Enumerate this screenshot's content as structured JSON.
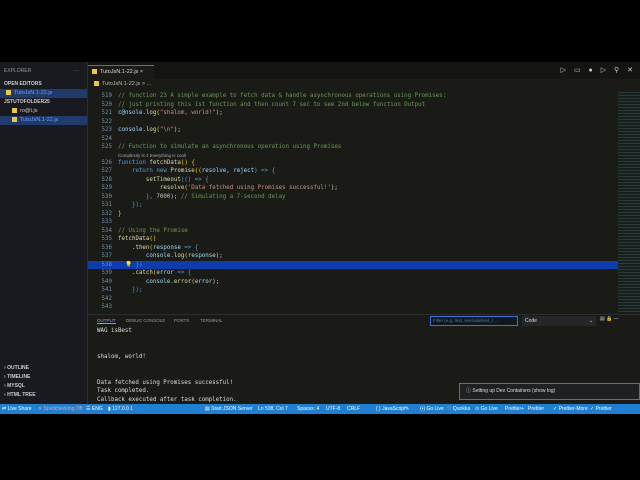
{
  "sidebar": {
    "title": "EXPLORER",
    "more": "···",
    "open_editors": "OPEN EDITORS",
    "open_file": "TutoJsN.1-22.js",
    "folder": "JSTUTOFOLDER25",
    "files": [
      "ro@t.js",
      "TutoJsN.1-22.js"
    ],
    "sections": [
      "OUTLINE",
      "TIMELINE",
      "MYSQL",
      "HTML TREE"
    ]
  },
  "tab": {
    "label": "TutoJsN.1-22.js",
    "close": "×"
  },
  "toolbar": {
    "icons": "▷ ▭ ● ▷ ⚲ ✕"
  },
  "breadcrumb": "TutoJsN.1-22.js > ...",
  "code": {
    "lens": "Complexity is 4 Everything is cool!",
    "lines": [
      {
        "n": "519",
        "t": [
          [
            "// function 23 A simple example to fetch data & handle asynchronous operations using Promises:",
            "c"
          ]
        ]
      },
      {
        "n": "520",
        "t": [
          [
            "// just printing this 1st function and then count 7 sec to see 2nd below function Output",
            "c"
          ]
        ]
      },
      {
        "n": "521",
        "t": [
          [
            "c@nsole",
            "v"
          ],
          [
            ".",
            "p"
          ],
          [
            "log",
            "f"
          ],
          [
            "(",
            "y"
          ],
          [
            "\"shalom, world!\"",
            "s"
          ],
          [
            ")",
            "y"
          ],
          [
            ";",
            "p"
          ]
        ]
      },
      {
        "n": "522",
        "t": []
      },
      {
        "n": "523",
        "t": [
          [
            "console",
            "v"
          ],
          [
            ".",
            "p"
          ],
          [
            "log",
            "f"
          ],
          [
            "(",
            "y"
          ],
          [
            "\"\\n\"",
            "s"
          ],
          [
            ")",
            "y"
          ],
          [
            ";",
            "p"
          ]
        ]
      },
      {
        "n": "524",
        "t": []
      },
      {
        "n": "525",
        "t": [
          [
            "// Function to simulate an asynchronous operation using Promises",
            "c"
          ]
        ]
      },
      {
        "n": "526",
        "t": [
          [
            "function ",
            "k"
          ],
          [
            "fetchData",
            "f"
          ],
          [
            "() {",
            "y"
          ]
        ],
        "lens": true
      },
      {
        "n": "527",
        "t": [
          [
            "    return new ",
            "k"
          ],
          [
            "Promise",
            "f"
          ],
          [
            "((",
            "y"
          ],
          [
            "resolve",
            "v"
          ],
          [
            ", ",
            "p"
          ],
          [
            "reject",
            "v"
          ],
          [
            ") => {",
            "k"
          ]
        ]
      },
      {
        "n": "528",
        "t": [
          [
            "        setTimeout",
            "f"
          ],
          [
            "(() => {",
            "k"
          ]
        ]
      },
      {
        "n": "529",
        "t": [
          [
            "            resolve",
            "f"
          ],
          [
            "(",
            "y"
          ],
          [
            "'Data fetched using Promises successful!'",
            "s"
          ],
          [
            ");",
            "p"
          ]
        ]
      },
      {
        "n": "530",
        "t": [
          [
            "        }, ",
            "k"
          ],
          [
            "7000",
            "n"
          ],
          [
            "); ",
            "p"
          ],
          [
            "// Simulating a 7-second delay",
            "c"
          ]
        ]
      },
      {
        "n": "531",
        "t": [
          [
            "    });",
            "k"
          ]
        ]
      },
      {
        "n": "532",
        "t": [
          [
            "}",
            "y"
          ]
        ]
      },
      {
        "n": "533",
        "t": []
      },
      {
        "n": "534",
        "t": [
          [
            "// Using the Promise",
            "c"
          ]
        ]
      },
      {
        "n": "535",
        "t": [
          [
            "fetchData",
            "f"
          ],
          [
            "()",
            "y"
          ]
        ]
      },
      {
        "n": "536",
        "t": [
          [
            "    .",
            "p"
          ],
          [
            "then",
            "f"
          ],
          [
            "(",
            "y"
          ],
          [
            "response",
            "v"
          ],
          [
            " => {",
            "k"
          ]
        ]
      },
      {
        "n": "537",
        "t": [
          [
            "        console",
            "v"
          ],
          [
            ".",
            "p"
          ],
          [
            "log",
            "f"
          ],
          [
            "(",
            "y"
          ],
          [
            "response",
            "v"
          ],
          [
            ");",
            "p"
          ]
        ]
      },
      {
        "n": "538",
        "t": [
          [
            "  💡 })",
            "k"
          ]
        ],
        "cur": true
      },
      {
        "n": "539",
        "t": [
          [
            "    .",
            "p"
          ],
          [
            "catch",
            "f"
          ],
          [
            "(",
            "y"
          ],
          [
            "error",
            "v"
          ],
          [
            " => {",
            "k"
          ]
        ]
      },
      {
        "n": "540",
        "t": [
          [
            "        console",
            "v"
          ],
          [
            ".",
            "p"
          ],
          [
            "error",
            "f"
          ],
          [
            "(",
            "y"
          ],
          [
            "error",
            "v"
          ],
          [
            ");",
            "p"
          ]
        ]
      },
      {
        "n": "541",
        "t": [
          [
            "    });",
            "k"
          ]
        ]
      },
      {
        "n": "542",
        "t": []
      },
      {
        "n": "543",
        "t": []
      }
    ]
  },
  "panel": {
    "tabs": [
      "OUTPUT",
      "DEBUG CONSOLE",
      "PORTS",
      "TERMINAL"
    ],
    "filter_placeholder": "Filter (e.g. text, !exclude\\text, !...",
    "channel": "Code",
    "controls": "▤ 🔒 —",
    "output": [
      "WAG isBest",
      "",
      "",
      "shalom, world!",
      "",
      "",
      "Data fetched using Promises successful!",
      "Task completed.",
      "Callback executed after task completion."
    ]
  },
  "toast": "ⓘ Setting up Dev Containers (show log)",
  "status": [
    "⇄ Live Share",
    "✕ Spellchecking Off",
    "☰ ENG",
    "▮ 127.0.0.1",
    "▤ Start JSON Server",
    "Ln 538, Col 7",
    "Spaces: 4",
    "UTF-8",
    "CRLF",
    "{ } JavaScript",
    "✎",
    "(•) Go Live",
    "♡ Quokka",
    "⊙ Go Live",
    "Prettier+",
    "Prettier",
    "✓ Prettier-More",
    "✓ Prettier"
  ]
}
